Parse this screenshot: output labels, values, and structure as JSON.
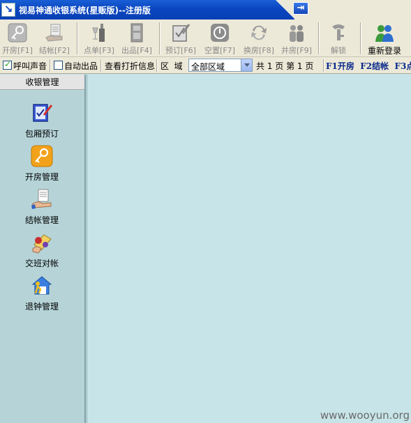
{
  "window": {
    "title": "视易神通收银系统(星贩版)--注册版"
  },
  "toolbar": {
    "buttons": [
      {
        "label": "开房[F1]",
        "icon": "key-icon"
      },
      {
        "label": "结帐[F2]",
        "icon": "checkout-hand-icon"
      },
      {
        "label": "点单[F3]",
        "icon": "wine-bottle-icon"
      },
      {
        "label": "出品[F4]",
        "icon": "cabinet-icon"
      },
      {
        "label": "预订[F6]",
        "icon": "clipboard-pen-icon"
      },
      {
        "label": "空置[F7]",
        "icon": "power-icon"
      },
      {
        "label": "换房[F8]",
        "icon": "swap-arrows-icon"
      },
      {
        "label": "并房[F9]",
        "icon": "group-users-icon"
      },
      {
        "label": "解锁",
        "icon": "unlock-key-icon"
      },
      {
        "label": "重新登录",
        "icon": "users-login-icon"
      }
    ]
  },
  "options": {
    "sound": {
      "label": "呼叫声音",
      "checked": true
    },
    "auto_out": {
      "label": "自动出品",
      "checked": false
    },
    "discount_info": "查看打折信息",
    "area_label": "区  域",
    "area_value": "全部区域",
    "page_text": "共 1 页 第 1 页",
    "shortcut_text": "F1开房  F2结帐  F3点"
  },
  "sidebar": {
    "header": "收银管理",
    "items": [
      {
        "label": "包厢预订",
        "icon": "booking-icon"
      },
      {
        "label": "开房管理",
        "icon": "key-icon"
      },
      {
        "label": "结帐管理",
        "icon": "checkout-hand-icon"
      },
      {
        "label": "交班对帐",
        "icon": "shift-handover-icon"
      },
      {
        "label": "退钟管理",
        "icon": "home-runner-icon"
      }
    ]
  },
  "watermark": "www.wooyun.org"
}
